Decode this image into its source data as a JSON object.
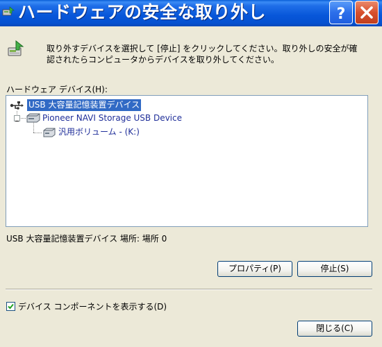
{
  "window": {
    "title": "ハードウェアの安全な取り外し",
    "help_button": "?",
    "close_button": "×"
  },
  "description": "取り外すデバイスを選択して [停止] をクリックしてください。取り外しの安全が確\n認されたらコンピュータからデバイスを取り外してください。",
  "hardware_label": "ハードウェア デバイス(H):",
  "tree": {
    "items": [
      {
        "label": "USB 大容量記憶装置デバイス",
        "icon": "usb-icon",
        "level": 0,
        "selected": true
      },
      {
        "label": "Pioneer NAVI Storage USB Device",
        "icon": "drive-icon",
        "level": 1,
        "expanded": true
      },
      {
        "label": "汎用ボリューム - (K:)",
        "icon": "volume-icon",
        "level": 2
      }
    ]
  },
  "status_text": "USB 大容量記憶装置デバイス 場所: 場所 0",
  "buttons": {
    "properties": "プロパティ(P)",
    "stop": "停止(S)",
    "close": "閉じる(C)"
  },
  "checkbox": {
    "label": "デバイス コンポーネントを表示する(D)",
    "checked": true
  },
  "colors": {
    "titlebar": "#0756d9",
    "selection": "#316ac5",
    "dialog_bg": "#ece9d8",
    "link_text": "#1f2e99"
  }
}
